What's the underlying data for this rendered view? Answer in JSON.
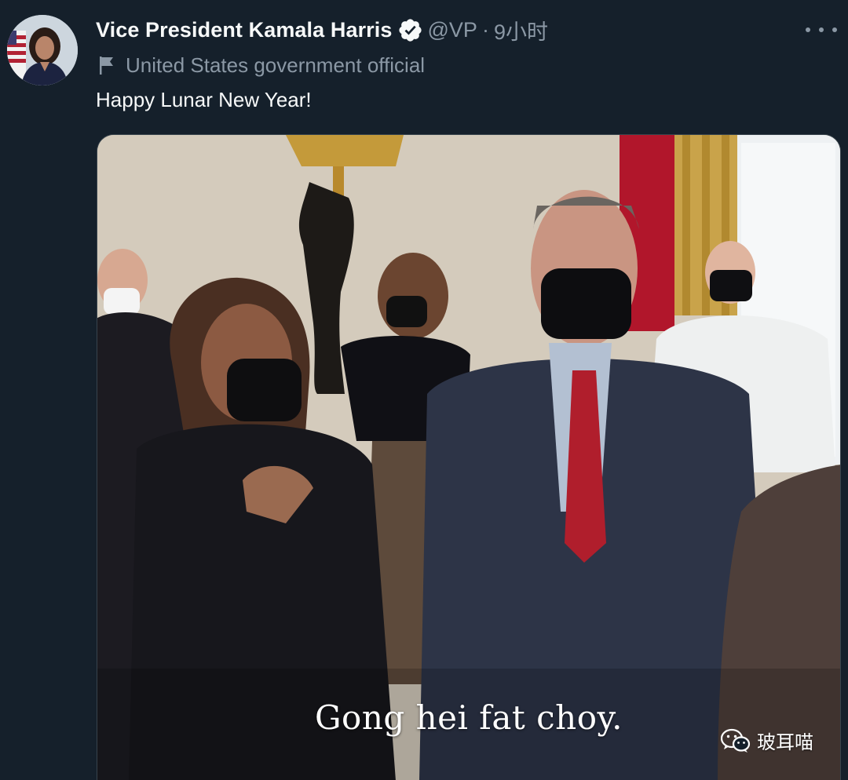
{
  "tweet": {
    "author_name": "Vice President Kamala Harris",
    "handle": "@VP",
    "separator": "·",
    "timestamp": "9小时",
    "account_label": "United States government official",
    "text": "Happy Lunar New Year!",
    "icons": {
      "verified": "verified-badge-icon",
      "label": "flag-icon",
      "more": "more-options-icon"
    }
  },
  "media": {
    "caption": "Gong hei fat choy."
  },
  "watermark": {
    "text": "玻耳喵",
    "icon": "wechat-icon"
  },
  "colors": {
    "background": "#15202b",
    "primary_text": "#f7f9f9",
    "secondary_text": "#8b98a5",
    "verified_badge": "#f7f9f9"
  }
}
